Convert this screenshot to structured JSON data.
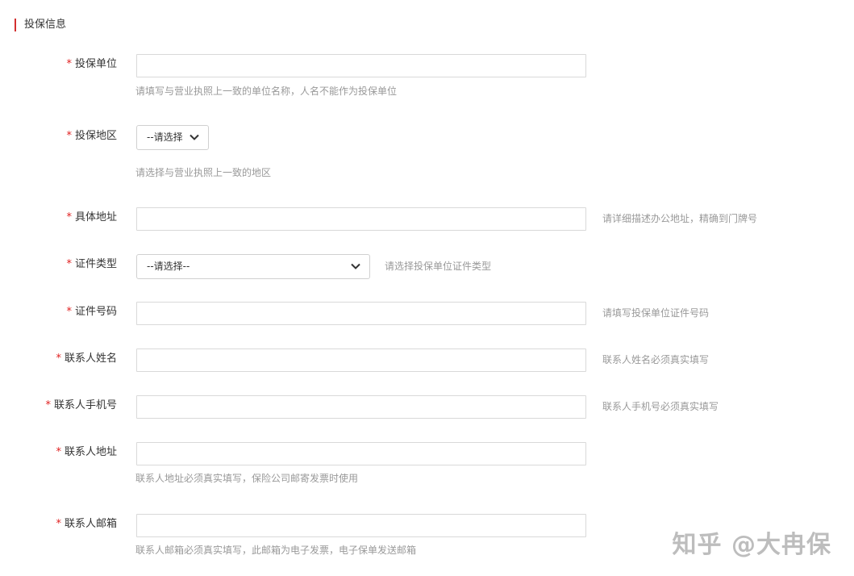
{
  "section": {
    "title": "投保信息",
    "accent_color": "#d32f2f"
  },
  "required_mark": "*",
  "fields": {
    "company": {
      "label": "投保单位",
      "value": "",
      "hint": "请填写与营业执照上一致的单位名称，人名不能作为投保单位"
    },
    "region": {
      "label": "投保地区",
      "selected": "--请选择",
      "hint": "请选择与营业执照上一致的地区"
    },
    "address": {
      "label": "具体地址",
      "value": "",
      "hint": "请详细描述办公地址，精确到门牌号"
    },
    "cert_type": {
      "label": "证件类型",
      "selected": "--请选择--",
      "hint": "请选择投保单位证件类型"
    },
    "cert_number": {
      "label": "证件号码",
      "value": "",
      "hint": "请填写投保单位证件号码"
    },
    "contact_name": {
      "label": "联系人姓名",
      "value": "",
      "hint": "联系人姓名必须真实填写"
    },
    "contact_phone": {
      "label": "联系人手机号",
      "value": "",
      "hint": "联系人手机号必须真实填写"
    },
    "contact_address": {
      "label": "联系人地址",
      "value": "",
      "hint": "联系人地址必须真实填写，保险公司邮寄发票时使用"
    },
    "contact_email": {
      "label": "联系人邮箱",
      "value": "",
      "hint": "联系人邮箱必须真实填写，此邮箱为电子发票，电子保单发送邮箱"
    }
  },
  "watermark": "知乎 @大冉保"
}
